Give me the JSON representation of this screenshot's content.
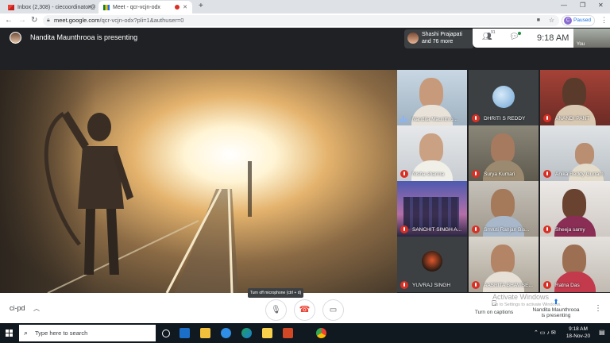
{
  "browser": {
    "tabs": [
      {
        "title": "Inbox (2,308) - ciecoordinator@",
        "active": false
      },
      {
        "title": "Meet - qcr-vcjn-odx",
        "active": true
      }
    ],
    "url_host": "meet.google.com",
    "url_path": "/qcr-vcjn-odx?pli=1&authuser=0",
    "profile_initial": "C",
    "profile_status": "Paused"
  },
  "meet": {
    "presenting_text": "Nandita Maunthrooa is presenting",
    "overflow": {
      "line1": "Shashi Prajapati",
      "line2": "and 76 more"
    },
    "participant_count": "91",
    "time": "9:18 AM",
    "self_label": "You",
    "participants": [
      {
        "name": "Nandita Maunthro...",
        "speaking": true
      },
      {
        "name": "DHRITI S REDDY",
        "speaking": false
      },
      {
        "name": "ANANDI PANT",
        "speaking": false
      },
      {
        "name": "Nisha sharma",
        "speaking": false
      },
      {
        "name": "Surya Kumari",
        "speaking": false
      },
      {
        "name": "Anika Reddy Gurram",
        "speaking": false
      },
      {
        "name": "SANCHIT SINGH A...",
        "speaking": false
      },
      {
        "name": "Smruti Ranjan Bis...",
        "speaking": false
      },
      {
        "name": "Sheeja samy",
        "speaking": false
      },
      {
        "name": "YUVRAJ SINGH",
        "speaking": false
      },
      {
        "name": "AASRITA BHAVISE...",
        "speaking": false
      },
      {
        "name": "Ratna Das",
        "speaking": false
      }
    ],
    "meeting_code": "ci-pd",
    "mic_tooltip": "Turn off microphone (ctrl + d)",
    "captions_label": "Turn on captions",
    "present_label_1": "Nandita Maunthrooa",
    "present_label_2": "is presenting",
    "activate_title": "Activate Windows",
    "activate_sub": "Go to Settings to activate Windows."
  },
  "taskbar": {
    "search_placeholder": "Type here to search",
    "time": "9:18 AM",
    "date": "18-Nov-20"
  },
  "colors": {
    "meet_bg": "#202124",
    "mute_red": "#d93025",
    "end_call_red": "#ea4335",
    "accent_blue": "#1a73e8"
  }
}
